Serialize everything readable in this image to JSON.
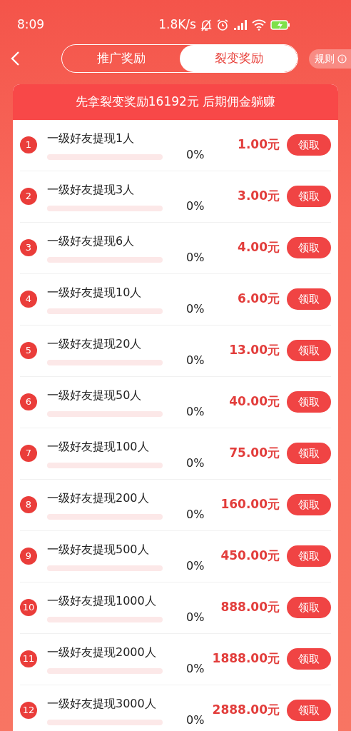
{
  "status_bar": {
    "time": "8:09",
    "speed": "1.8K/s"
  },
  "tabs": [
    {
      "label": "推广奖励",
      "selected": false
    },
    {
      "label": "裂变奖励",
      "selected": true
    }
  ],
  "rules_link": "规则",
  "banner": "先拿裂变奖励16192元 后期佣金躺赚",
  "rewards": [
    {
      "index": "1",
      "title": "一级好友提现1人",
      "level": 0,
      "percent": "0%",
      "amount": "1.00元",
      "button": "领取"
    },
    {
      "index": "2",
      "title": "一级好友提现3人",
      "level": 0,
      "percent": "0%",
      "amount": "3.00元",
      "button": "领取"
    },
    {
      "index": "3",
      "title": "一级好友提现6人",
      "level": 0,
      "percent": "0%",
      "amount": "4.00元",
      "button": "领取"
    },
    {
      "index": "4",
      "title": "一级好友提现10人",
      "level": 0,
      "percent": "0%",
      "amount": "6.00元",
      "button": "领取"
    },
    {
      "index": "5",
      "title": "一级好友提现20人",
      "level": 0,
      "percent": "0%",
      "amount": "13.00元",
      "button": "领取"
    },
    {
      "index": "6",
      "title": "一级好友提现50人",
      "level": 0,
      "percent": "0%",
      "amount": "40.00元",
      "button": "领取"
    },
    {
      "index": "7",
      "title": "一级好友提现100人",
      "level": 0,
      "percent": "0%",
      "amount": "75.00元",
      "button": "领取"
    },
    {
      "index": "8",
      "title": "一级好友提现200人",
      "level": 0,
      "percent": "0%",
      "amount": "160.00元",
      "button": "领取"
    },
    {
      "index": "9",
      "title": "一级好友提现500人",
      "level": 0,
      "percent": "0%",
      "amount": "450.00元",
      "button": "领取"
    },
    {
      "index": "10",
      "title": "一级好友提现1000人",
      "level": 0,
      "percent": "0%",
      "amount": "888.00元",
      "button": "领取"
    },
    {
      "index": "11",
      "title": "一级好友提现2000人",
      "level": 0,
      "percent": "0%",
      "amount": "1888.00元",
      "button": "领取"
    },
    {
      "index": "12",
      "title": "一级好友提现3000人",
      "level": 0,
      "percent": "0%",
      "amount": "2888.00元",
      "button": "领取"
    }
  ]
}
